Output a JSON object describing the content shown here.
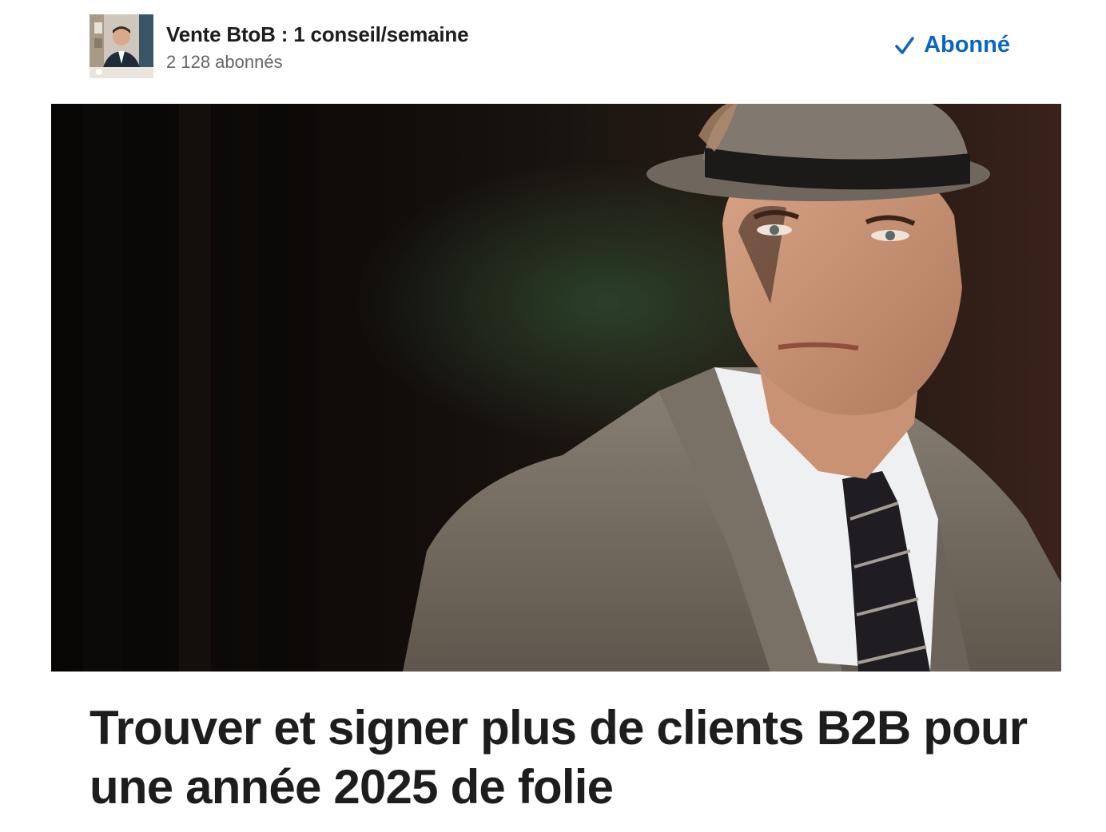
{
  "newsletter": {
    "title": "Vente BtoB : 1 conseil/semaine",
    "subscribers": "2 128 abonnés",
    "avatar_icon": "author-avatar"
  },
  "subscribe": {
    "label": "Abonné",
    "icon": "check-icon",
    "color": "#0a66c2"
  },
  "article": {
    "title": "Trouver et signer plus de clients B2B pour une année 2025 de folie"
  }
}
